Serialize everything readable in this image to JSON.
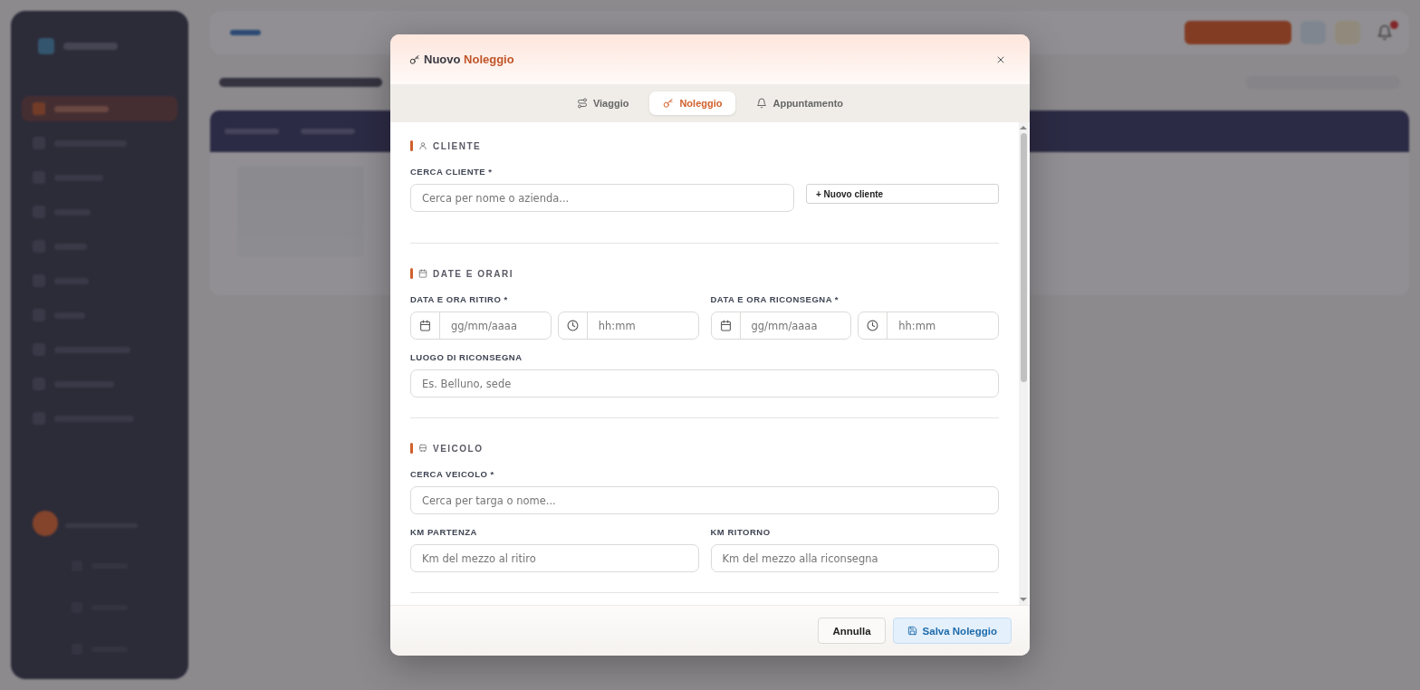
{
  "background": {
    "sidebar": {
      "items": [
        {
          "selected": true
        },
        {
          "selected": false
        },
        {
          "selected": false
        },
        {
          "selected": false
        },
        {
          "selected": false
        },
        {
          "selected": false
        },
        {
          "selected": false
        },
        {
          "selected": false
        },
        {
          "selected": false
        },
        {
          "selected": false
        }
      ]
    }
  },
  "dialog": {
    "title": {
      "text": "Nuovo",
      "accent": "Noleggio"
    },
    "tabs": [
      {
        "label": "Viaggio",
        "selected": false
      },
      {
        "label": "Noleggio",
        "selected": true
      },
      {
        "label": "Appuntamento",
        "selected": false
      }
    ],
    "sections": [
      {
        "title": "CLIENTE",
        "rows": [
          {
            "kind": "search",
            "groups": [
              {
                "label": "CERCA CLIENTE *",
                "inputs": [
                  {
                    "kind": "text",
                    "placeholder": "Cerca per nome o azienda..."
                  }
                ]
              },
              {
                "button": "+ Nuovo cliente"
              }
            ]
          }
        ]
      },
      {
        "title": "DATE E ORARI",
        "rows": [
          {
            "kind": "split",
            "groups": [
              {
                "label": "DATA E ORA RITIRO *",
                "inputs": [
                  {
                    "kind": "date",
                    "placeholder": "gg/mm/aaaa"
                  },
                  {
                    "kind": "time",
                    "placeholder": "hh:mm"
                  }
                ]
              },
              {
                "label": "DATA E ORA RICONSEGNA *",
                "inputs": [
                  {
                    "kind": "date",
                    "placeholder": "gg/mm/aaaa"
                  },
                  {
                    "kind": "time",
                    "placeholder": "hh:mm"
                  }
                ]
              }
            ]
          },
          {
            "kind": "full",
            "groups": [
              {
                "label": "LUOGO DI RICONSEGNA",
                "inputs": [
                  {
                    "kind": "text",
                    "placeholder": "Es. Belluno, sede"
                  }
                ]
              }
            ]
          }
        ]
      },
      {
        "title": "VEICOLO",
        "rows": [
          {
            "kind": "full",
            "groups": [
              {
                "label": "CERCA VEICOLO *",
                "inputs": [
                  {
                    "kind": "text",
                    "placeholder": "Cerca per targa o nome..."
                  }
                ]
              }
            ]
          },
          {
            "kind": "split",
            "groups": [
              {
                "label": "KM PARTENZA",
                "inputs": [
                  {
                    "kind": "text",
                    "placeholder": "Km del mezzo al ritiro"
                  }
                ]
              },
              {
                "label": "KM RITORNO",
                "inputs": [
                  {
                    "kind": "text",
                    "placeholder": "Km del mezzo alla riconsegna"
                  }
                ]
              }
            ]
          }
        ]
      }
    ],
    "buttons": [
      {
        "label": "Annulla",
        "kind": "secondary"
      },
      {
        "label": "Salva Noleggio",
        "kind": "primary"
      }
    ]
  }
}
